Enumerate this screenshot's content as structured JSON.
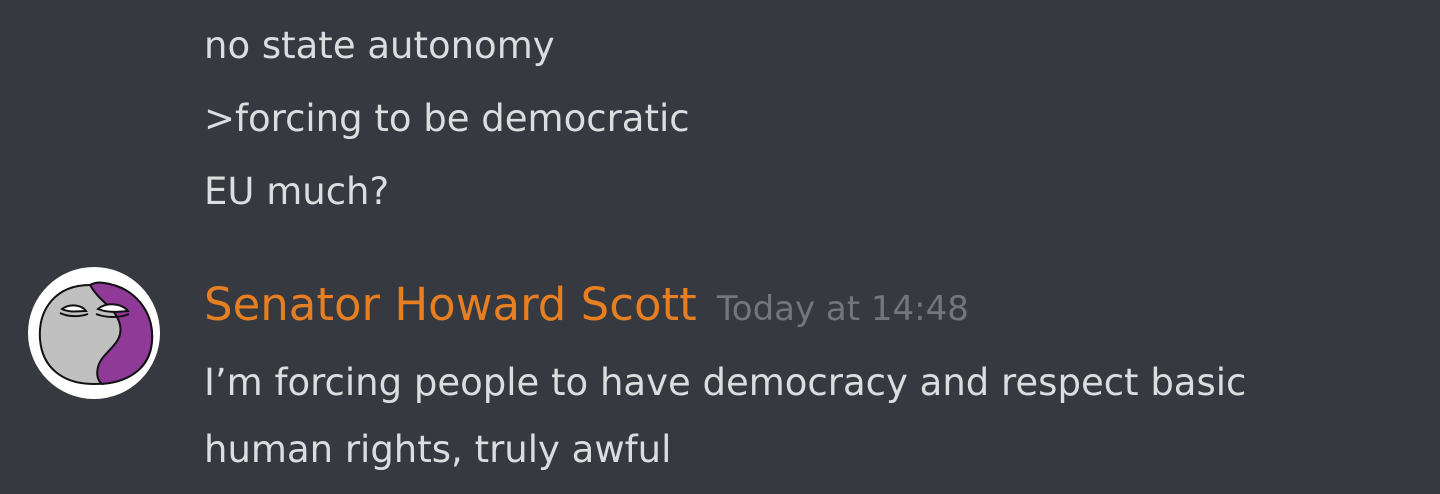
{
  "previous_messages": [
    "no state autonomy",
    ">forcing to be democratic",
    "EU much?"
  ],
  "message": {
    "author": "Senator Howard Scott",
    "author_color": "#e67e22",
    "timestamp": "Today at 14:48",
    "lines": [
      "I’m forcing people to have democracy and respect basic",
      "human rights, truly awful"
    ],
    "avatar_icon": "purple-grey-countryball-avatar"
  },
  "colors": {
    "background": "#36393f",
    "text": "#dcddde",
    "timestamp": "#72767d"
  }
}
